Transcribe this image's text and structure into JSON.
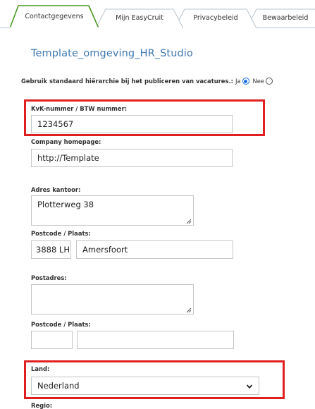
{
  "tabs": [
    {
      "label": "Contactgegevens",
      "active": true
    },
    {
      "label": "Mijn EasyCruit",
      "active": false
    },
    {
      "label": "Privacybeleid",
      "active": false
    },
    {
      "label": "Bewaarbeleid",
      "active": false
    }
  ],
  "page": {
    "title": "Template_omgeving_HR_Studio"
  },
  "hierarchy": {
    "question": "Gebruik standaard hiërarchie bij het publiceren van vacatures.:",
    "option_yes": "Ja",
    "option_no": "Nee",
    "selected": "Ja"
  },
  "form": {
    "kvk": {
      "label": "KvK-nummer / BTW nummer:",
      "value": "1234567"
    },
    "homepage": {
      "label": "Company homepage:",
      "value": "http://Template"
    },
    "office_address": {
      "label": "Adres kantoor:",
      "value": "Plotterweg 38"
    },
    "office_postcode_city": {
      "label": "Postcode / Plaats:",
      "postcode": "3888 LH",
      "city": "Amersfoort"
    },
    "postal_address": {
      "label": "Postadres:",
      "value": ""
    },
    "postal_postcode_city": {
      "label": "Postcode / Plaats:",
      "postcode": "",
      "city": ""
    },
    "country": {
      "label": "Land:",
      "value": "Nederland"
    },
    "region": {
      "label": "Regio:"
    }
  },
  "colors": {
    "accent_title": "#3f79b0",
    "highlight": "#e02020",
    "radio_selected": "#1a6fe0"
  }
}
